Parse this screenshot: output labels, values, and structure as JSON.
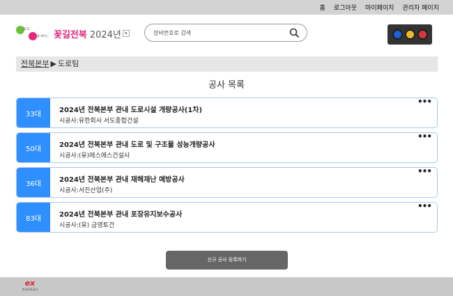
{
  "topnav": {
    "home": "홈",
    "logout": "로그아웃",
    "mypage": "마이페이지",
    "admin": "관리자 페이지"
  },
  "header": {
    "logo_small_text_1": "보고,",
    "logo_small_text_2": "를 케우는",
    "logo_title": "꽃길전북",
    "year": "2024년",
    "search_placeholder": "장비번호로 검색"
  },
  "traffic_lights": [
    "#1e5fd6",
    "#e8b92f",
    "#d8373a"
  ],
  "breadcrumb": {
    "parent": "전북본부",
    "separator": "▶",
    "current": "도로팀"
  },
  "page_title": "공사 목록",
  "projects": [
    {
      "num": "33대",
      "title": "2024년 전북본부 관내 도로시설 개량공사(1차)",
      "contractor": "시공사:유한회사 서도종합건설"
    },
    {
      "num": "50대",
      "title": "2024년 전북본부 관내 도로 및 구조물 성능개량공사",
      "contractor": "시공사:(유)에스에스건설사"
    },
    {
      "num": "36대",
      "title": "2024년 전북본부 관내 재해재난 예방공사",
      "contractor": "시공사:서진산업(주)"
    },
    {
      "num": "83대",
      "title": "2024년 전북본부 관내 포장유지보수공사",
      "contractor": "시공사:(유) 금영토건"
    }
  ],
  "more_symbol": "•••",
  "register_button": "신규 공사 등록하기",
  "footer": {
    "logo_mark": "ex",
    "logo_text": "한국도로공사"
  },
  "colors": {
    "accent": "#2f8fff",
    "card_border": "#aac8ee",
    "brand_pink": "#e2287f"
  }
}
